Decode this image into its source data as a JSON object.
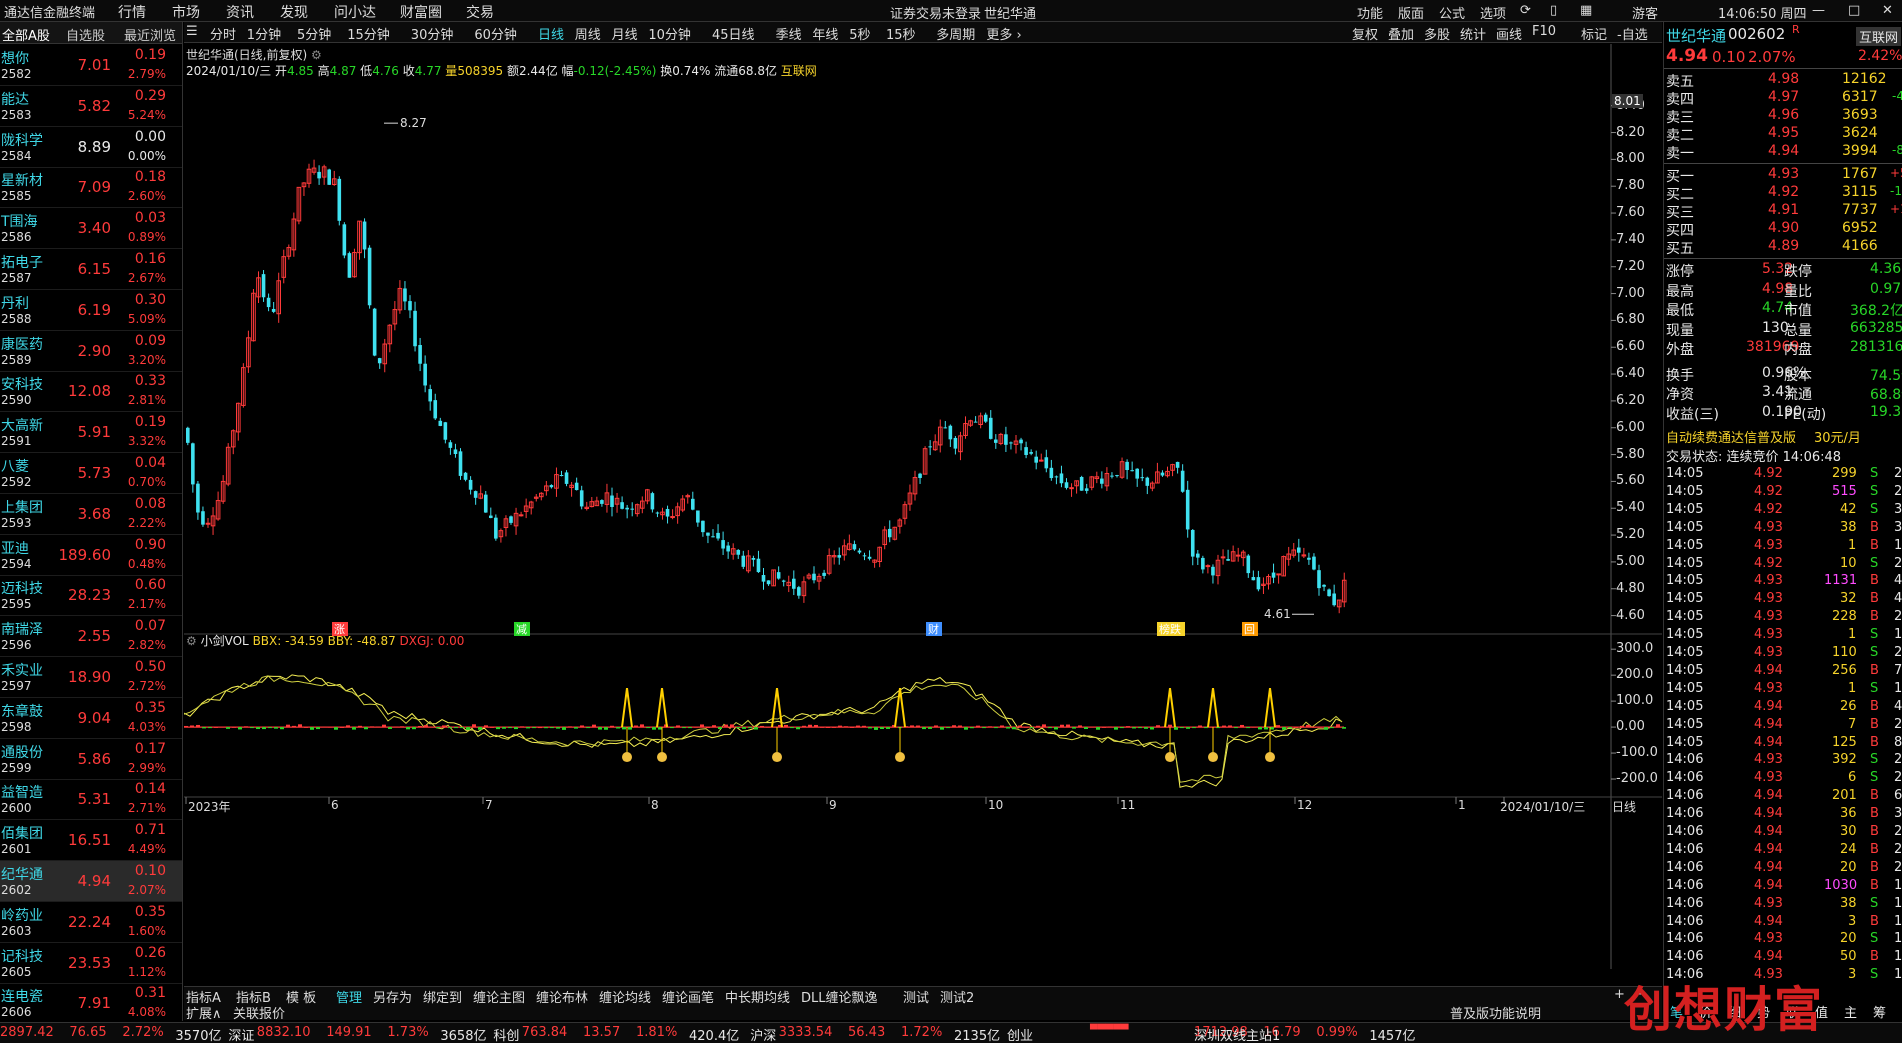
{
  "menu": {
    "app_title": "通达信金融终端",
    "items": [
      "行情",
      "市场",
      "资讯",
      "发现",
      "问小达",
      "财富圈",
      "交易"
    ],
    "login_warning": "证券交易未登录",
    "stock_name": "世纪华通",
    "right_items": [
      "功能",
      "版面",
      "公式",
      "选项"
    ],
    "guest": "游客",
    "clock": "14:06:50 周四"
  },
  "watchlist": {
    "headers": [
      "全部A股",
      "自选股",
      "最近浏览"
    ],
    "rows": [
      {
        "name": "想你",
        "code": "2582",
        "price": "7.01",
        "chg": "0.19",
        "pct": "2.79%",
        "dir": "up"
      },
      {
        "name": "能达",
        "code": "2583",
        "price": "5.82",
        "chg": "0.29",
        "pct": "5.24%",
        "dir": "up"
      },
      {
        "name": "陇科学",
        "code": "2584",
        "price": "8.89",
        "chg": "0.00",
        "pct": "0.00%",
        "dir": "flat"
      },
      {
        "name": "星新材",
        "code": "2585",
        "price": "7.09",
        "chg": "0.18",
        "pct": "2.60%",
        "dir": "up"
      },
      {
        "name": "T围海",
        "code": "2586",
        "price": "3.40",
        "chg": "0.03",
        "pct": "0.89%",
        "dir": "up"
      },
      {
        "name": "拓电子",
        "code": "2587",
        "price": "6.15",
        "chg": "0.16",
        "pct": "2.67%",
        "dir": "up"
      },
      {
        "name": "丹利",
        "code": "2588",
        "price": "6.19",
        "chg": "0.30",
        "pct": "5.09%",
        "dir": "up"
      },
      {
        "name": "康医药",
        "code": "2589",
        "price": "2.90",
        "chg": "0.09",
        "pct": "3.20%",
        "dir": "up"
      },
      {
        "name": "安科技",
        "code": "2590",
        "price": "12.08",
        "chg": "0.33",
        "pct": "2.81%",
        "dir": "up"
      },
      {
        "name": "大高新",
        "code": "2591",
        "price": "5.91",
        "chg": "0.19",
        "pct": "3.32%",
        "dir": "up"
      },
      {
        "name": "八菱",
        "code": "2592",
        "price": "5.73",
        "chg": "0.04",
        "pct": "0.70%",
        "dir": "up"
      },
      {
        "name": "上集团",
        "code": "2593",
        "price": "3.68",
        "chg": "0.08",
        "pct": "2.22%",
        "dir": "up"
      },
      {
        "name": "亚迪",
        "code": "2594",
        "price": "189.60",
        "chg": "0.90",
        "pct": "0.48%",
        "dir": "up"
      },
      {
        "name": "迈科技",
        "code": "2595",
        "price": "28.23",
        "chg": "0.60",
        "pct": "2.17%",
        "dir": "up"
      },
      {
        "name": "南瑞泽",
        "code": "2596",
        "price": "2.55",
        "chg": "0.07",
        "pct": "2.82%",
        "dir": "up"
      },
      {
        "name": "禾实业",
        "code": "2597",
        "price": "18.90",
        "chg": "0.50",
        "pct": "2.72%",
        "dir": "up"
      },
      {
        "name": "东章鼓",
        "code": "2598",
        "price": "9.04",
        "chg": "0.35",
        "pct": "4.03%",
        "dir": "up"
      },
      {
        "name": "通股份",
        "code": "2599",
        "price": "5.86",
        "chg": "0.17",
        "pct": "2.99%",
        "dir": "up"
      },
      {
        "name": "益智造",
        "code": "2600",
        "price": "5.31",
        "chg": "0.14",
        "pct": "2.71%",
        "dir": "up"
      },
      {
        "name": "佰集团",
        "code": "2601",
        "price": "16.51",
        "chg": "0.71",
        "pct": "4.49%",
        "dir": "up"
      },
      {
        "name": "纪华通",
        "code": "2602",
        "price": "4.94",
        "chg": "0.10",
        "pct": "2.07%",
        "dir": "up",
        "sel": true
      },
      {
        "name": "岭药业",
        "code": "2603",
        "price": "22.24",
        "chg": "0.35",
        "pct": "1.60%",
        "dir": "up"
      },
      {
        "name": "记科技",
        "code": "2605",
        "price": "23.53",
        "chg": "0.26",
        "pct": "1.12%",
        "dir": "up"
      },
      {
        "name": "连电瓷",
        "code": "2606",
        "price": "7.91",
        "chg": "0.31",
        "pct": "4.08%",
        "dir": "up"
      }
    ]
  },
  "toolbar": {
    "periods": [
      "分时",
      "1分钟",
      "5分钟",
      "15分钟",
      "30分钟",
      "60分钟",
      "日线",
      "周线",
      "月线",
      "10分钟",
      "45日线",
      "季线",
      "年线",
      "5秒",
      "15秒",
      "多周期",
      "更多 ›"
    ],
    "active": "日线",
    "right": [
      "复权",
      "叠加",
      "多股",
      "统计",
      "画线",
      "F10",
      "标记",
      "-自选",
      "返回"
    ]
  },
  "chart": {
    "title": "世纪华通(日线,前复权)",
    "info_date": "2024/01/10/三",
    "open_l": "开",
    "open": "4.85",
    "high_l": "高",
    "high": "4.87",
    "low_l": "低",
    "low": "4.76",
    "close_l": "收",
    "close": "4.77",
    "vol_l": "量",
    "vol": "508395",
    "amt_l": "额",
    "amt": "2.44亿",
    "chg_l": "幅",
    "chg": "-0.12(-2.45%)",
    "turn_l": "换",
    "turn": "0.74%",
    "float_l": "流通",
    "float": "68.8亿",
    "source": "互联网",
    "max_label": "8.27",
    "min_label": "4.61",
    "cursor_value": "8.01",
    "yticks": [
      "8.40",
      "8.20",
      "8.00",
      "7.80",
      "7.60",
      "7.40",
      "7.20",
      "7.00",
      "6.80",
      "6.60",
      "6.40",
      "6.20",
      "6.00",
      "5.80",
      "5.60",
      "5.40",
      "5.20",
      "5.00",
      "4.80",
      "4.60"
    ],
    "events": [
      {
        "t": "涨",
        "c": "#ff3b3b"
      },
      {
        "t": "减",
        "c": "#28d628"
      },
      {
        "t": "财",
        "c": "#3f8fff"
      },
      {
        "t": "榜跌",
        "c": "#f6d32b"
      },
      {
        "t": "回",
        "c": "#ff9a00"
      }
    ],
    "ind_name": "小剑VOL",
    "ind_bbx": "BBX: -34.59",
    "ind_bby": "BBY: -48.87",
    "ind_dx": "DXGJ: 0.00",
    "ind_yticks": [
      "300.0",
      "200.0",
      "100.0",
      "0.00",
      "-100.0",
      "-200.0"
    ],
    "months": [
      "2023年",
      "6",
      "7",
      "8",
      "9",
      "10",
      "11",
      "12",
      "1",
      "2024/01/10/三"
    ],
    "period_label": "日线"
  },
  "chart_data": {
    "type": "candlestick",
    "title": "世纪华通(日线,前复权)",
    "ylim": [
      4.5,
      8.45
    ],
    "x_range": [
      "2023年",
      "2024/01/10/三"
    ],
    "max_price": 8.27,
    "min_price": 4.61,
    "last": {
      "date": "2024/01/10",
      "open": 4.85,
      "high": 4.87,
      "low": 4.76,
      "close": 4.77
    },
    "indicator": {
      "name": "小剑VOL",
      "BBX": -34.59,
      "BBY": -48.87,
      "DXGJ": 0.0,
      "ylim": [
        -250,
        320
      ]
    }
  },
  "bottom_tabs": [
    "指标A",
    "指标B",
    "模 板",
    "管理",
    "另存为",
    "绑定到",
    "缠论主图",
    "缠论布林",
    "缠论均线",
    "缠论画笔",
    "中长期均线",
    "DLL缠论飘逸",
    "测试",
    "测试2"
  ],
  "bottom_tabs_active": "管理",
  "bottom_tabs2": [
    "扩展∧",
    "关联报价"
  ],
  "pro_note": "普及版功能说明",
  "quote": {
    "name": "世纪华通",
    "code": "002602",
    "flag": "R",
    "price": "4.94",
    "chg": "0.10",
    "pct": "2.07%",
    "net_label": "互联网",
    "net_pct": "2.42%",
    "asks": [
      {
        "l": "卖五",
        "p": "4.98",
        "v": "12162",
        "d": ""
      },
      {
        "l": "卖四",
        "p": "4.97",
        "v": "6317",
        "d": "-40"
      },
      {
        "l": "卖三",
        "p": "4.96",
        "v": "3693",
        "d": ""
      },
      {
        "l": "卖二",
        "p": "4.95",
        "v": "3624",
        "d": ""
      },
      {
        "l": "卖一",
        "p": "4.94",
        "v": "3994",
        "d": "-80"
      }
    ],
    "bids": [
      {
        "l": "买一",
        "p": "4.93",
        "v": "1767",
        "d": "+573"
      },
      {
        "l": "买二",
        "p": "4.92",
        "v": "3115",
        "d": "-111"
      },
      {
        "l": "买三",
        "p": "4.91",
        "v": "7737",
        "d": "+13"
      },
      {
        "l": "买四",
        "p": "4.90",
        "v": "6952",
        "d": ""
      },
      {
        "l": "买五",
        "p": "4.89",
        "v": "4166",
        "d": ""
      }
    ],
    "stats": [
      [
        "涨停",
        "5.32",
        "跌停",
        "4.36"
      ],
      [
        "最高",
        "4.98",
        "量比",
        "0.97"
      ],
      [
        "最低",
        "4.74",
        "市值",
        "368.2亿"
      ],
      [
        "现量",
        "130",
        "总量",
        "663285"
      ],
      [
        "外盘",
        "381969",
        "内盘",
        "281316"
      ],
      [
        "换手",
        "0.96%",
        "股本",
        "74.5亿"
      ],
      [
        "净资",
        "3.41",
        "流通",
        "68.8亿"
      ],
      [
        "收益(三)",
        "0.190",
        "PE(动)",
        "19.3"
      ]
    ],
    "promo": "自动续费通达信普及版",
    "promo_price": "30元/月",
    "trade_state": "交易状态: 连续竞价 14:06:48",
    "ticks": [
      [
        "14:05",
        "4.92",
        "299",
        "S",
        "2"
      ],
      [
        "14:05",
        "4.92",
        "515",
        "S",
        "27"
      ],
      [
        "14:05",
        "4.92",
        "42",
        "S",
        "3"
      ],
      [
        "14:05",
        "4.93",
        "38",
        "B",
        "3"
      ],
      [
        "14:05",
        "4.93",
        "1",
        "B",
        "1"
      ],
      [
        "14:05",
        "4.92",
        "10",
        "S",
        "2"
      ],
      [
        "14:05",
        "4.93",
        "1131",
        "B",
        "40"
      ],
      [
        "14:05",
        "4.93",
        "32",
        "B",
        "4"
      ],
      [
        "14:05",
        "4.93",
        "228",
        "B",
        "25"
      ],
      [
        "14:05",
        "4.93",
        "1",
        "S",
        "1"
      ],
      [
        "14:05",
        "4.93",
        "110",
        "S",
        "2"
      ],
      [
        "14:05",
        "4.94",
        "256",
        "B",
        "7"
      ],
      [
        "14:05",
        "4.93",
        "1",
        "S",
        "1"
      ],
      [
        "14:05",
        "4.94",
        "26",
        "B",
        "4"
      ],
      [
        "14:05",
        "4.94",
        "7",
        "B",
        "2"
      ],
      [
        "14:05",
        "4.94",
        "125",
        "B",
        "8"
      ],
      [
        "14:06",
        "4.93",
        "392",
        "S",
        "2"
      ],
      [
        "14:06",
        "4.93",
        "6",
        "S",
        "2"
      ],
      [
        "14:06",
        "4.94",
        "201",
        "B",
        "6"
      ],
      [
        "14:06",
        "4.94",
        "36",
        "B",
        "3"
      ],
      [
        "14:06",
        "4.94",
        "30",
        "B",
        "2"
      ],
      [
        "14:06",
        "4.94",
        "24",
        "B",
        "2"
      ],
      [
        "14:06",
        "4.94",
        "20",
        "B",
        "2"
      ],
      [
        "14:06",
        "4.94",
        "1030",
        "B",
        "1"
      ],
      [
        "14:06",
        "4.93",
        "38",
        "S",
        "1"
      ],
      [
        "14:06",
        "4.94",
        "3",
        "B",
        "1"
      ],
      [
        "14:06",
        "4.93",
        "20",
        "S",
        "1"
      ],
      [
        "14:06",
        "4.94",
        "50",
        "B",
        "1"
      ],
      [
        "14:06",
        "4.93",
        "3",
        "S",
        "1"
      ]
    ],
    "tabs": [
      "笔",
      "价",
      "细",
      "势",
      "联",
      "值",
      "主",
      "筹"
    ]
  },
  "status": [
    {
      "t": "2897.42",
      "c": "red"
    },
    {
      "t": "76.65",
      "c": "red"
    },
    {
      "t": "2.72%",
      "c": "red"
    },
    {
      "t": "3570亿",
      "c": "wht"
    },
    {
      "t": "深证",
      "c": "wht"
    },
    {
      "t": "8832.10",
      "c": "red"
    },
    {
      "t": "149.91",
      "c": "red"
    },
    {
      "t": "1.73%",
      "c": "red"
    },
    {
      "t": "3658亿",
      "c": "wht"
    },
    {
      "t": "科创",
      "c": "wht"
    },
    {
      "t": "763.84",
      "c": "red"
    },
    {
      "t": "13.57",
      "c": "red"
    },
    {
      "t": "1.81%",
      "c": "red"
    },
    {
      "t": "420.4亿",
      "c": "wht"
    },
    {
      "t": "沪深",
      "c": "wht"
    },
    {
      "t": "3333.54",
      "c": "red"
    },
    {
      "t": "56.43",
      "c": "red"
    },
    {
      "t": "1.72%",
      "c": "red"
    },
    {
      "t": "2135亿",
      "c": "wht"
    },
    {
      "t": "创业",
      "c": "wht"
    },
    {
      "t": "1712.98",
      "c": "red"
    },
    {
      "t": "16.79",
      "c": "red"
    },
    {
      "t": "0.99%",
      "c": "red"
    },
    {
      "t": "1457亿",
      "c": "wht"
    },
    {
      "t": "深圳双线主站1",
      "c": "wht"
    }
  ],
  "watermark": "创想财富"
}
